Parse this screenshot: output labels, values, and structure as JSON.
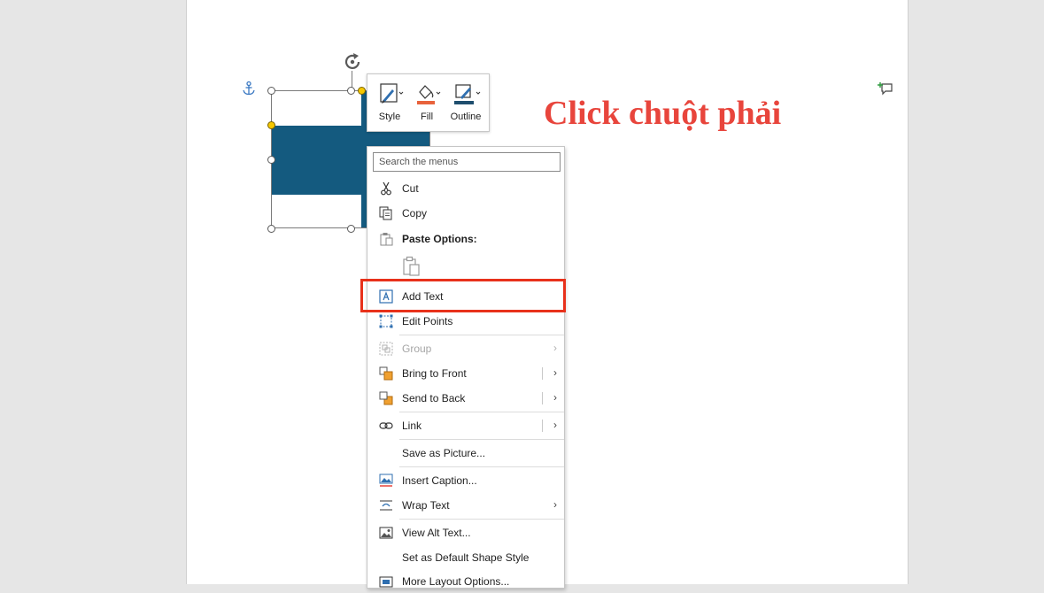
{
  "annotation": {
    "text": "Click chuột phải"
  },
  "mini_toolbar": {
    "style_label": "Style",
    "fill_label": "Fill",
    "outline_label": "Outline"
  },
  "colors": {
    "shape_fill": "#145a7f",
    "annotation": "#e8453c",
    "highlight": "#e8311b",
    "fill_swatch": "#e8623c",
    "outline_swatch": "#1e4e6e"
  },
  "context_menu": {
    "search_placeholder": "Search the menus",
    "items": {
      "cut": "Cut",
      "copy": "Copy",
      "paste_options": "Paste Options:",
      "add_text": "Add Text",
      "edit_points": "Edit Points",
      "group": "Group",
      "bring_to_front": "Bring to Front",
      "send_to_back": "Send to Back",
      "link": "Link",
      "save_as_picture": "Save as Picture...",
      "insert_caption": "Insert Caption...",
      "wrap_text": "Wrap Text",
      "view_alt_text": "View Alt Text...",
      "set_default_shape_style": "Set as Default Shape Style",
      "more_layout_options": "More Layout Options..."
    }
  }
}
